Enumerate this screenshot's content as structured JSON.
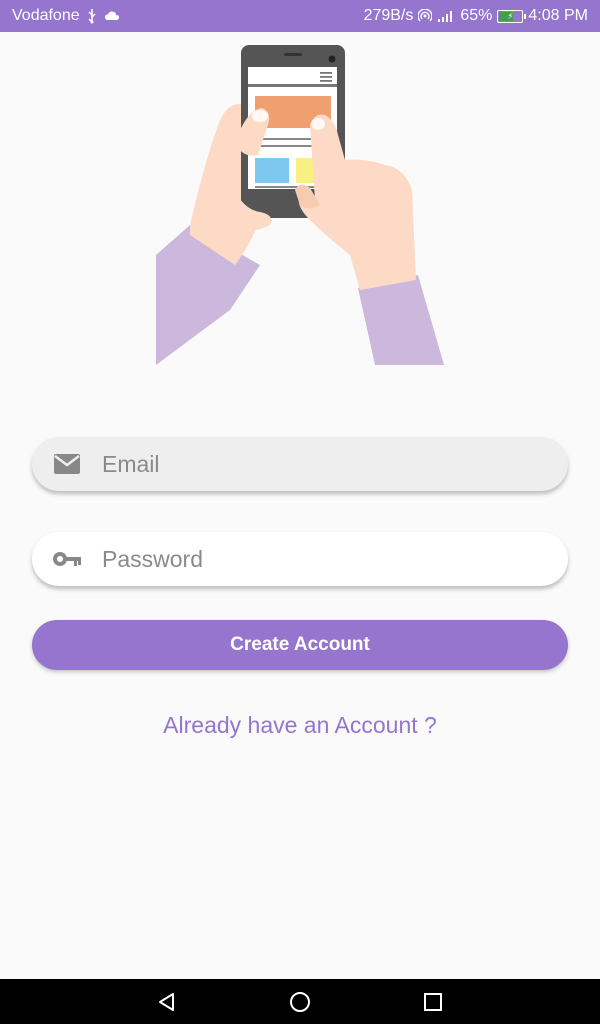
{
  "status_bar": {
    "carrier": "Vodafone",
    "speed": "279B/s",
    "battery_percent": "65%",
    "battery_level": 0.65,
    "time": "4:08 PM",
    "color": "#9575cd"
  },
  "form": {
    "email_placeholder": "Email",
    "password_placeholder": "Password",
    "email_icon": "mail-icon",
    "password_icon": "key-icon"
  },
  "actions": {
    "create_account_label": "Create Account",
    "login_link_label": "Already have an Account ?"
  },
  "theme": {
    "accent": "#9575cd",
    "background": "#fafafa"
  }
}
